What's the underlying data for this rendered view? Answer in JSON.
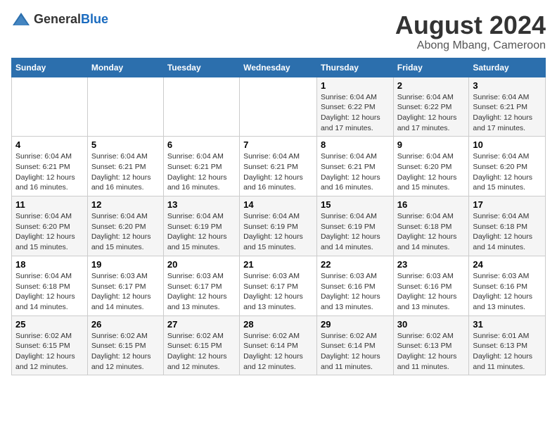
{
  "header": {
    "logo_general": "General",
    "logo_blue": "Blue",
    "main_title": "August 2024",
    "subtitle": "Abong Mbang, Cameroon"
  },
  "days_of_week": [
    "Sunday",
    "Monday",
    "Tuesday",
    "Wednesday",
    "Thursday",
    "Friday",
    "Saturday"
  ],
  "weeks": [
    [
      {
        "day": "",
        "info": ""
      },
      {
        "day": "",
        "info": ""
      },
      {
        "day": "",
        "info": ""
      },
      {
        "day": "",
        "info": ""
      },
      {
        "day": "1",
        "info": "Sunrise: 6:04 AM\nSunset: 6:22 PM\nDaylight: 12 hours and 17 minutes."
      },
      {
        "day": "2",
        "info": "Sunrise: 6:04 AM\nSunset: 6:22 PM\nDaylight: 12 hours and 17 minutes."
      },
      {
        "day": "3",
        "info": "Sunrise: 6:04 AM\nSunset: 6:21 PM\nDaylight: 12 hours and 17 minutes."
      }
    ],
    [
      {
        "day": "4",
        "info": "Sunrise: 6:04 AM\nSunset: 6:21 PM\nDaylight: 12 hours and 16 minutes."
      },
      {
        "day": "5",
        "info": "Sunrise: 6:04 AM\nSunset: 6:21 PM\nDaylight: 12 hours and 16 minutes."
      },
      {
        "day": "6",
        "info": "Sunrise: 6:04 AM\nSunset: 6:21 PM\nDaylight: 12 hours and 16 minutes."
      },
      {
        "day": "7",
        "info": "Sunrise: 6:04 AM\nSunset: 6:21 PM\nDaylight: 12 hours and 16 minutes."
      },
      {
        "day": "8",
        "info": "Sunrise: 6:04 AM\nSunset: 6:21 PM\nDaylight: 12 hours and 16 minutes."
      },
      {
        "day": "9",
        "info": "Sunrise: 6:04 AM\nSunset: 6:20 PM\nDaylight: 12 hours and 15 minutes."
      },
      {
        "day": "10",
        "info": "Sunrise: 6:04 AM\nSunset: 6:20 PM\nDaylight: 12 hours and 15 minutes."
      }
    ],
    [
      {
        "day": "11",
        "info": "Sunrise: 6:04 AM\nSunset: 6:20 PM\nDaylight: 12 hours and 15 minutes."
      },
      {
        "day": "12",
        "info": "Sunrise: 6:04 AM\nSunset: 6:20 PM\nDaylight: 12 hours and 15 minutes."
      },
      {
        "day": "13",
        "info": "Sunrise: 6:04 AM\nSunset: 6:19 PM\nDaylight: 12 hours and 15 minutes."
      },
      {
        "day": "14",
        "info": "Sunrise: 6:04 AM\nSunset: 6:19 PM\nDaylight: 12 hours and 15 minutes."
      },
      {
        "day": "15",
        "info": "Sunrise: 6:04 AM\nSunset: 6:19 PM\nDaylight: 12 hours and 14 minutes."
      },
      {
        "day": "16",
        "info": "Sunrise: 6:04 AM\nSunset: 6:18 PM\nDaylight: 12 hours and 14 minutes."
      },
      {
        "day": "17",
        "info": "Sunrise: 6:04 AM\nSunset: 6:18 PM\nDaylight: 12 hours and 14 minutes."
      }
    ],
    [
      {
        "day": "18",
        "info": "Sunrise: 6:04 AM\nSunset: 6:18 PM\nDaylight: 12 hours and 14 minutes."
      },
      {
        "day": "19",
        "info": "Sunrise: 6:03 AM\nSunset: 6:17 PM\nDaylight: 12 hours and 14 minutes."
      },
      {
        "day": "20",
        "info": "Sunrise: 6:03 AM\nSunset: 6:17 PM\nDaylight: 12 hours and 13 minutes."
      },
      {
        "day": "21",
        "info": "Sunrise: 6:03 AM\nSunset: 6:17 PM\nDaylight: 12 hours and 13 minutes."
      },
      {
        "day": "22",
        "info": "Sunrise: 6:03 AM\nSunset: 6:16 PM\nDaylight: 12 hours and 13 minutes."
      },
      {
        "day": "23",
        "info": "Sunrise: 6:03 AM\nSunset: 6:16 PM\nDaylight: 12 hours and 13 minutes."
      },
      {
        "day": "24",
        "info": "Sunrise: 6:03 AM\nSunset: 6:16 PM\nDaylight: 12 hours and 13 minutes."
      }
    ],
    [
      {
        "day": "25",
        "info": "Sunrise: 6:02 AM\nSunset: 6:15 PM\nDaylight: 12 hours and 12 minutes."
      },
      {
        "day": "26",
        "info": "Sunrise: 6:02 AM\nSunset: 6:15 PM\nDaylight: 12 hours and 12 minutes."
      },
      {
        "day": "27",
        "info": "Sunrise: 6:02 AM\nSunset: 6:15 PM\nDaylight: 12 hours and 12 minutes."
      },
      {
        "day": "28",
        "info": "Sunrise: 6:02 AM\nSunset: 6:14 PM\nDaylight: 12 hours and 12 minutes."
      },
      {
        "day": "29",
        "info": "Sunrise: 6:02 AM\nSunset: 6:14 PM\nDaylight: 12 hours and 11 minutes."
      },
      {
        "day": "30",
        "info": "Sunrise: 6:02 AM\nSunset: 6:13 PM\nDaylight: 12 hours and 11 minutes."
      },
      {
        "day": "31",
        "info": "Sunrise: 6:01 AM\nSunset: 6:13 PM\nDaylight: 12 hours and 11 minutes."
      }
    ]
  ]
}
